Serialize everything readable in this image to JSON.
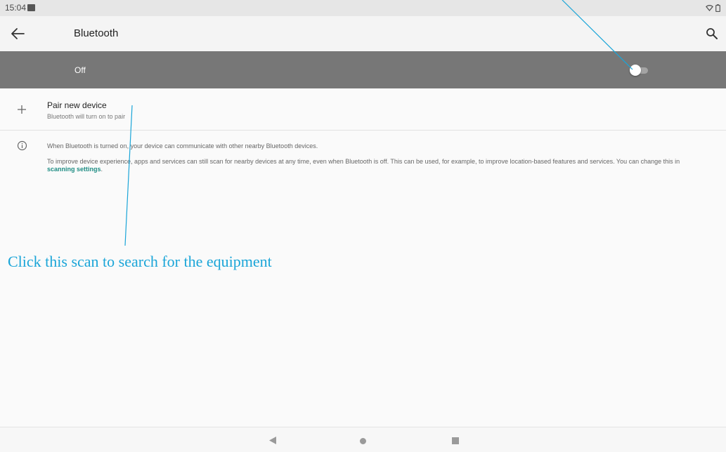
{
  "status_bar": {
    "time": "15:04",
    "icons": [
      "image-icon",
      "wifi-icon",
      "battery-icon"
    ]
  },
  "app_bar": {
    "title": "Bluetooth",
    "icons": [
      "back-arrow-icon",
      "search-icon"
    ]
  },
  "master_switch": {
    "label": "Off",
    "enabled": false
  },
  "pair_new_device": {
    "title": "Pair new device",
    "subtitle": "Bluetooth will turn on to pair",
    "icon": "plus-icon"
  },
  "info": {
    "icon": "info-icon",
    "line1": "When Bluetooth is turned on, your device can communicate with other nearby Bluetooth devices.",
    "line2_prefix": "To improve device experience, apps and services can still scan for nearby devices at any time, even when Bluetooth is off. This can be used, for example, to improve location-based features and services. You can change this in ",
    "link_text": "scanning settings",
    "line2_suffix": "."
  },
  "annotation": {
    "text": "Click this scan to search for the equipment",
    "color": "#1aa5d8"
  },
  "nav_bar": {
    "icons": [
      "nav-back-icon",
      "nav-home-icon",
      "nav-recents-icon"
    ]
  },
  "colors": {
    "switch_bar": "#777777",
    "link": "#1f8d84",
    "background": "#fafafa"
  }
}
